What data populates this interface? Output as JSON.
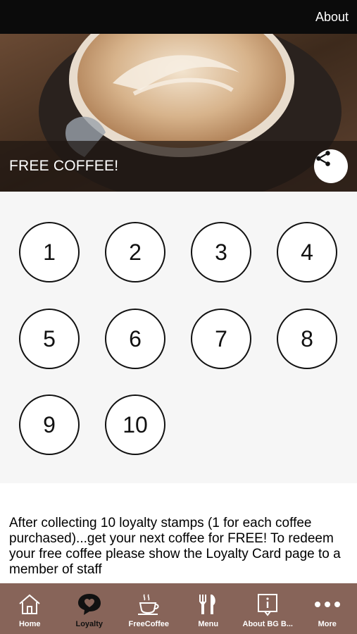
{
  "header": {
    "about_label": "About"
  },
  "hero": {
    "title": "FREE COFFEE!"
  },
  "stamps": [
    "1",
    "2",
    "3",
    "4",
    "5",
    "6",
    "7",
    "8",
    "9",
    "10"
  ],
  "description": "After collecting 10 loyalty stamps (1 for each coffee purchased)...get your next coffee for FREE! To redeem your free coffee please show the Loyalty Card page to a member of staff",
  "tabs": [
    {
      "label": "Home",
      "icon": "home-icon"
    },
    {
      "label": "Loyalty",
      "icon": "heart-bubble-icon"
    },
    {
      "label": "FreeCoffee",
      "icon": "coffee-cup-icon"
    },
    {
      "label": "Menu",
      "icon": "fork-knife-icon"
    },
    {
      "label": "About BG B...",
      "icon": "info-icon"
    },
    {
      "label": "More",
      "icon": "more-dots-icon"
    }
  ],
  "colors": {
    "topbar": "#0b0b0b",
    "tabbar": "#876459",
    "stamps_bg": "#f6f6f6"
  }
}
